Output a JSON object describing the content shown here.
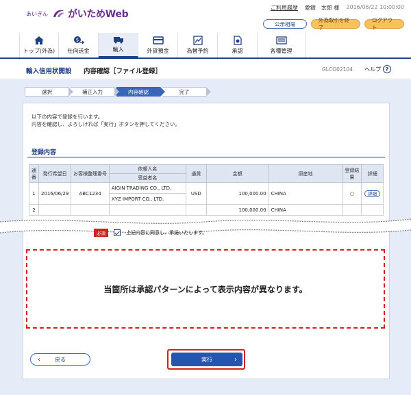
{
  "header": {
    "bank_name": "あいぎん",
    "app_name": "がいためWeb",
    "usage_history": "ご利用履歴",
    "user": "愛銀　太郎 様",
    "datetime": "2016/06/22 10:00:00",
    "public_rates": "公示相場",
    "end_fx": "外為取引を終了",
    "logout": "ログアウト"
  },
  "nav": [
    {
      "label": "トップ(外為)",
      "icon": "home-icon"
    },
    {
      "label": "仕向送金",
      "icon": "remittance-icon"
    },
    {
      "label": "輸入",
      "icon": "import-icon"
    },
    {
      "label": "外貨預金",
      "icon": "deposit-icon"
    },
    {
      "label": "為替予約",
      "icon": "exchange-contract-icon"
    },
    {
      "label": "承認",
      "icon": "approval-icon"
    },
    {
      "label": "各種管理",
      "icon": "management-icon"
    }
  ],
  "titlebar": {
    "page_title": "輸入信用状開設",
    "screen_name": "内容確認［ファイル登録］",
    "screen_id": "GLCO02104",
    "help": "ヘルプ"
  },
  "steps": [
    "選択",
    "補正入力",
    "内容確認",
    "完了"
  ],
  "message": {
    "line1": "以下の内容で登録を行います。",
    "line2": "内容を確認し、よろしければ「実行」ボタンを押してください。"
  },
  "section_title": "登録内容",
  "table": {
    "headers": {
      "no": "通番",
      "issue_date": "発行希望日",
      "ref_no": "お客様整理番号",
      "applicant": "依頼人名",
      "beneficiary": "受益者名",
      "currency": "通貨",
      "amount": "金額",
      "origin": "原産地",
      "result": "登録結果",
      "detail": "詳細"
    },
    "rows": [
      {
        "no": "1",
        "issue_date": "2016/06/29",
        "ref_no": "ABC1234",
        "applicant": "AIGIN TRADING CO., LTD.",
        "beneficiary": "XYZ IMPORT CO., LTD.",
        "currency": "USD",
        "amount": "100,000.00",
        "origin": "CHINA",
        "result": "○",
        "detail": "詳細"
      }
    ],
    "partial_row": {
      "no": "2",
      "amount": "100,000.00",
      "origin": "CHINA"
    }
  },
  "agree": {
    "required": "必須",
    "label": "上記内容に同意し、承諾いたします。"
  },
  "notice": "当箇所は承認パターンによって表示内容が異なります。",
  "buttons": {
    "back": "戻る",
    "execute": "実行"
  }
}
